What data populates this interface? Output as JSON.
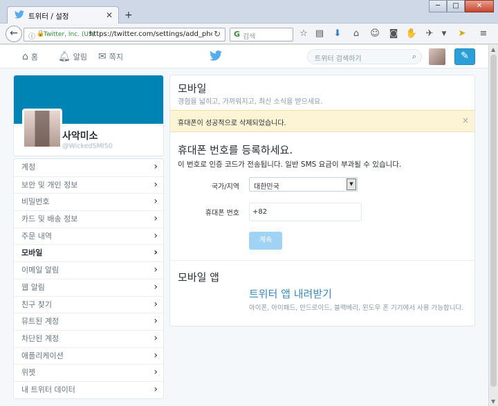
{
  "browser": {
    "tab_title": "트위터 / 설정",
    "new_tab": "+",
    "url_identity": "Twitter, Inc. (US)",
    "url": "https://twitter.com/settings/add_phor",
    "search_placeholder": "검색",
    "window_buttons": {
      "minimize": "─",
      "maximize": "□",
      "close": "✕"
    }
  },
  "nav": {
    "home": "홈",
    "notifications": "알림",
    "messages": "쪽지",
    "search_placeholder": "트위터 검색하기"
  },
  "profile": {
    "name": "사악미소",
    "handle": "@WickedSMI50"
  },
  "menu": [
    {
      "label": "계정",
      "active": false
    },
    {
      "label": "보안 및 개인 정보",
      "active": false
    },
    {
      "label": "비밀번호",
      "active": false
    },
    {
      "label": "카드 및 배송 정보",
      "active": false
    },
    {
      "label": "주문 내역",
      "active": false
    },
    {
      "label": "모바일",
      "active": true
    },
    {
      "label": "이메일 알림",
      "active": false
    },
    {
      "label": "웹 알림",
      "active": false
    },
    {
      "label": "친구 찾기",
      "active": false
    },
    {
      "label": "뮤트된 계정",
      "active": false
    },
    {
      "label": "차단된 계정",
      "active": false
    },
    {
      "label": "애플리케이션",
      "active": false
    },
    {
      "label": "위젯",
      "active": false
    },
    {
      "label": "내 트위터 데이터",
      "active": false
    }
  ],
  "main": {
    "title": "모바일",
    "subtitle": "경험을 넓히고, 가까워지고, 최신 소식을 받으세요.",
    "alert": "휴대폰이 성공적으로 삭제되었습니다.",
    "alert_close": "×",
    "register_heading": "휴대폰 번호를 등록하세요.",
    "register_desc": "이 번호로 인증 코드가 전송됩니다. 일반 SMS 요금이 부과될 수 있습니다.",
    "country_label": "국가/지역",
    "country_value": "대한민국",
    "phone_label": "휴대폰 번호",
    "phone_prefix": "+82",
    "continue": "계속",
    "app_heading": "모바일 앱",
    "app_link": "트위터 앱 내려받기",
    "app_desc": "아이폰, 아이패드, 안드로이드, 블랙베리, 윈도우 폰 기기에서 사용 가능합니다."
  },
  "colors": {
    "twitter_blue": "#2b9fd9",
    "banner": "#0084b4",
    "alert_bg": "#fcf4d5",
    "link": "#3b88c3"
  }
}
